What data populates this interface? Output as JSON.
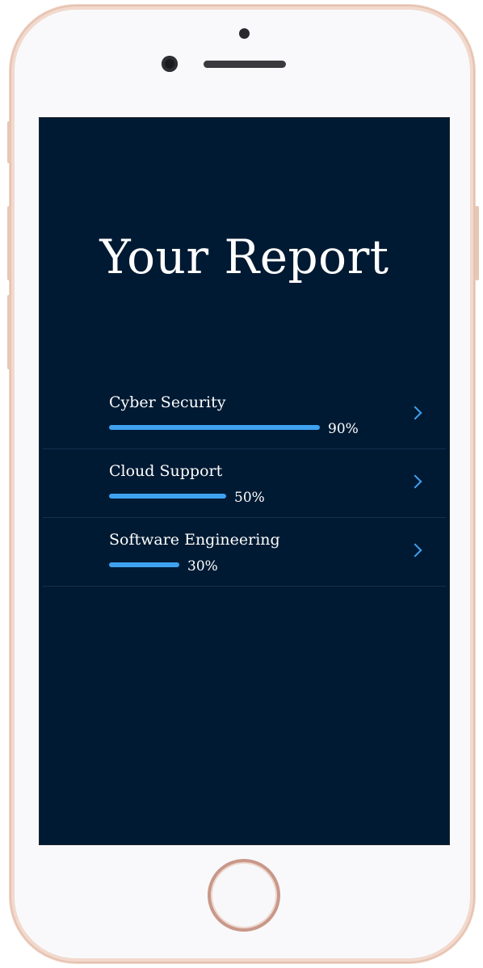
{
  "header": {
    "title": "Your Report"
  },
  "report": {
    "items": [
      {
        "label": "Cyber Security",
        "percent_text": "90%",
        "progress": 0.9
      },
      {
        "label": "Cloud Support",
        "percent_text": "50%",
        "progress": 0.5
      },
      {
        "label": "Software Engineering",
        "percent_text": "30%",
        "progress": 0.3
      }
    ]
  },
  "colors": {
    "screen_background": "#001a33",
    "accent": "#3fa2f1",
    "divider": "#12304d",
    "frame": "#f2d9cd"
  },
  "icons": {
    "row_action": "chevron-right-icon"
  }
}
